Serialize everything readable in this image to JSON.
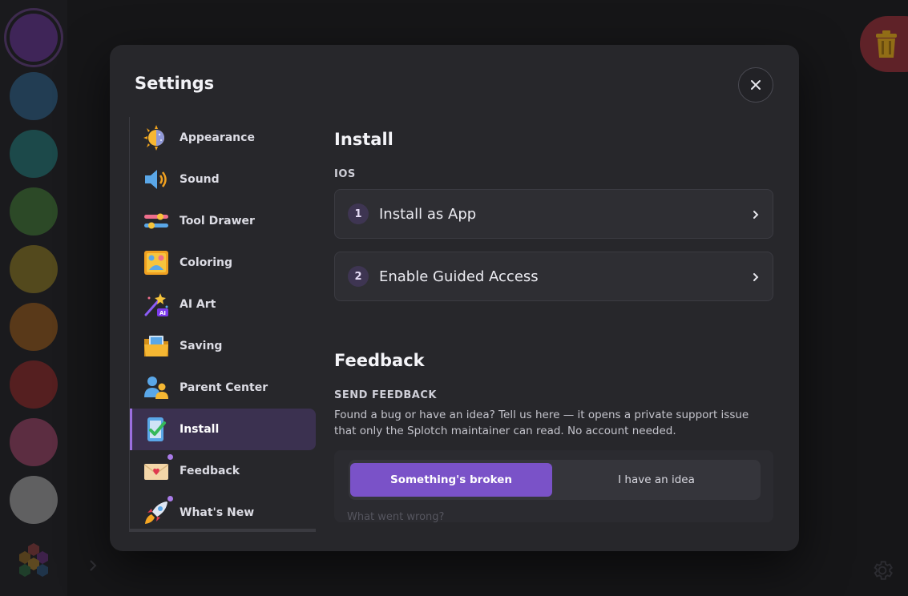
{
  "colors": {
    "swatches": [
      "#5b3480",
      "#2f5878",
      "#256b6b",
      "#3e6a35",
      "#7a6b26",
      "#83521f",
      "#7d2a2a",
      "#883f5c",
      "#8e8e8e"
    ],
    "accent": "#7a52c8",
    "trash": "#8c2f36"
  },
  "modal": {
    "title": "Settings",
    "nav": [
      {
        "label": "Appearance",
        "icon": "sun-moon-icon"
      },
      {
        "label": "Sound",
        "icon": "speaker-icon"
      },
      {
        "label": "Tool Drawer",
        "icon": "sliders-icon"
      },
      {
        "label": "Coloring",
        "icon": "palette-picture-icon"
      },
      {
        "label": "AI Art",
        "icon": "magic-wand-icon"
      },
      {
        "label": "Saving",
        "icon": "folder-icon"
      },
      {
        "label": "Parent Center",
        "icon": "people-icon"
      },
      {
        "label": "Install",
        "icon": "phone-check-icon",
        "active": true
      },
      {
        "label": "Feedback",
        "icon": "envelope-heart-icon",
        "dot": true
      },
      {
        "label": "What's New",
        "icon": "rocket-icon",
        "dot": true
      }
    ],
    "install": {
      "heading": "Install",
      "subheading": "IOS",
      "steps": [
        {
          "num": "1",
          "label": "Install as App"
        },
        {
          "num": "2",
          "label": "Enable Guided Access"
        }
      ]
    },
    "feedback": {
      "heading": "Feedback",
      "subheading": "SEND FEEDBACK",
      "description": "Found a bug or have an idea? Tell us here — it opens a private support issue that only the Splotch maintainer can read. No account needed.",
      "options": [
        "Something's broken",
        "I have an idea"
      ],
      "selected": "Something's broken",
      "placeholder": "What went wrong?"
    }
  }
}
